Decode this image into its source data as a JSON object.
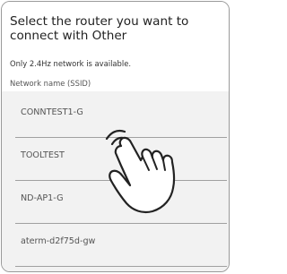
{
  "header": {
    "title": "Select the router you want to connect with Other",
    "subtitle": "Only 2.4Hz network is available.",
    "ssid_label": "Network name (SSID)"
  },
  "networks": [
    {
      "name": "CONNTEST1-G"
    },
    {
      "name": "TOOLTEST"
    },
    {
      "name": "ND-AP1-G"
    },
    {
      "name": "aterm-d2f75d-gw"
    }
  ],
  "overlay": {
    "icon": "tap-hand-icon"
  },
  "colors": {
    "list_background": "#f2f2f2",
    "text_primary": "#222222",
    "divider": "#a0a0a0"
  }
}
